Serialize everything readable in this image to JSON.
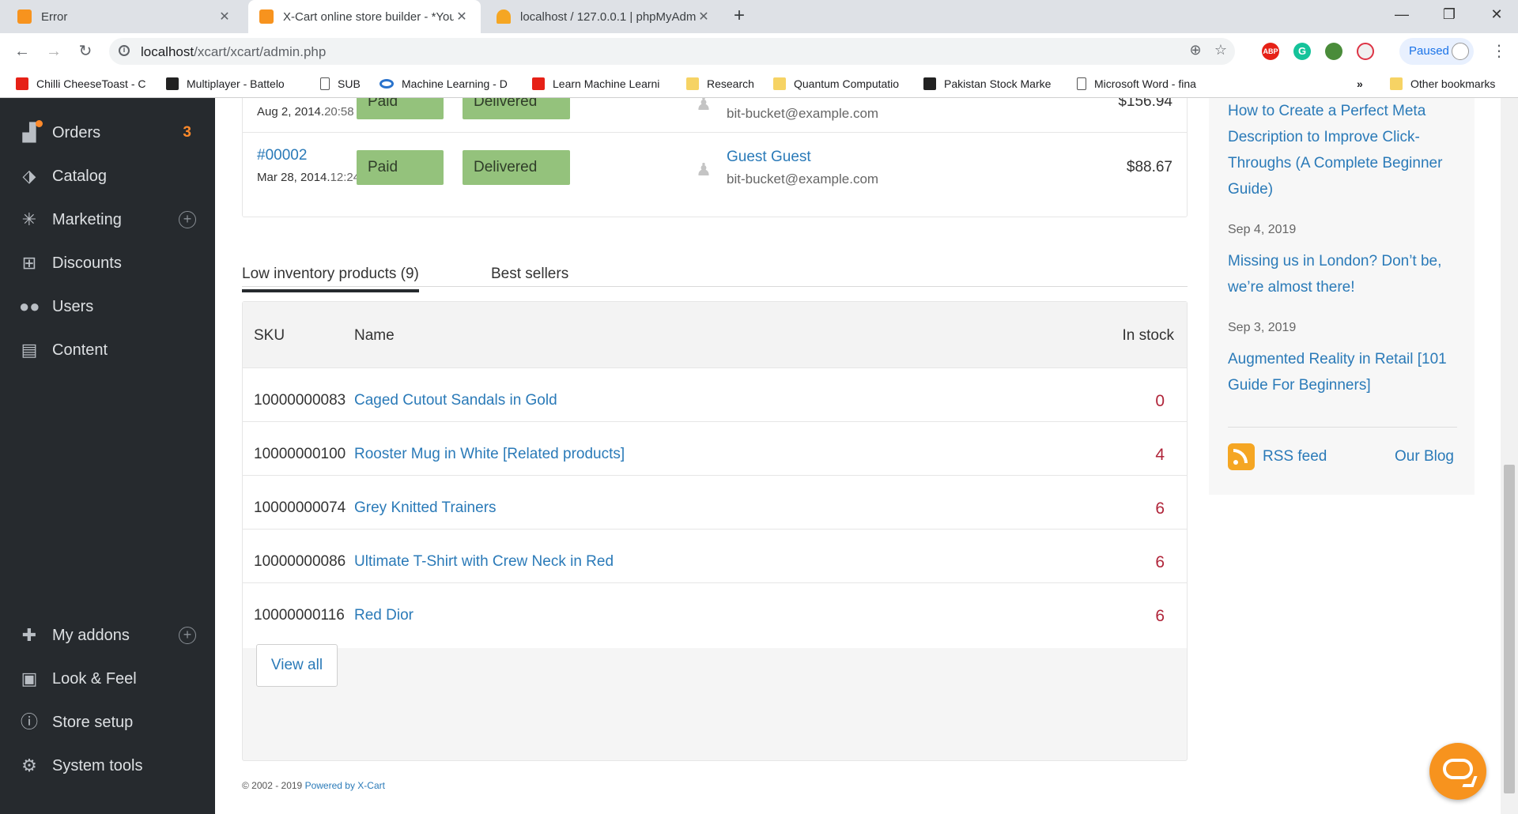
{
  "browser": {
    "tabs": [
      {
        "title": "Error",
        "favicon_color": "#f7931e",
        "active": false
      },
      {
        "title": "X-Cart online store builder - *You",
        "favicon_color": "#f7931e",
        "active": true
      },
      {
        "title": "localhost / 127.0.0.1 | phpMyAdm",
        "favicon_color": "#f5a623",
        "active": false
      }
    ],
    "url_host": "localhost",
    "url_path": "/xcart/xcart/admin.php",
    "profile_label": "Paused",
    "extensions": [
      "ABP",
      "G",
      "",
      ""
    ],
    "bookmarks": [
      {
        "label": "Chilli CheeseToast - C",
        "icon": "youtube-icon"
      },
      {
        "label": "Multiplayer - Battelo",
        "icon": "bl-icon"
      },
      {
        "label": "SUB",
        "icon": "page-icon"
      },
      {
        "label": "Machine Learning - D",
        "icon": "coursera-icon"
      },
      {
        "label": "Learn Machine Learni",
        "icon": "youtube-icon"
      },
      {
        "label": "Research",
        "icon": "folder-icon"
      },
      {
        "label": "Quantum Computatio",
        "icon": "folder-icon"
      },
      {
        "label": "Pakistan Stock Marke",
        "icon": "psx-icon"
      },
      {
        "label": "Microsoft Word - fina",
        "icon": "page-icon"
      }
    ],
    "bookmarks_overflow": "»",
    "other_bookmarks": "Other bookmarks"
  },
  "sidebar": {
    "items": [
      {
        "label": "Orders",
        "icon": "orders-icon",
        "count": "3"
      },
      {
        "label": "Catalog",
        "icon": "tag-icon"
      },
      {
        "label": "Marketing",
        "icon": "network-icon",
        "plus": true
      },
      {
        "label": "Discounts",
        "icon": "gift-icon"
      },
      {
        "label": "Users",
        "icon": "users-icon"
      },
      {
        "label": "Content",
        "icon": "newspaper-icon"
      }
    ],
    "bottom_items": [
      {
        "label": "My addons",
        "icon": "puzzle-icon",
        "plus": true
      },
      {
        "label": "Look & Feel",
        "icon": "image-icon"
      },
      {
        "label": "Store setup",
        "icon": "info-icon"
      },
      {
        "label": "System tools",
        "icon": "gear-icon"
      }
    ]
  },
  "orders": [
    {
      "number": "",
      "date": "Aug 2, 2014.",
      "time": "20:58",
      "payment": "Paid",
      "shipping": "Delivered",
      "customer": "",
      "email": "bit-bucket@example.com",
      "total": "$156.94"
    },
    {
      "number": "#00002",
      "date": "Mar 28, 2014.",
      "time": "12:24",
      "payment": "Paid",
      "shipping": "Delivered",
      "customer": "Guest Guest",
      "email": "bit-bucket@example.com",
      "total": "$88.67"
    }
  ],
  "inventory_tabs": {
    "low_inventory": "Low inventory products (9)",
    "best_sellers": "Best sellers"
  },
  "inventory_table": {
    "headers": {
      "sku": "SKU",
      "name": "Name",
      "stock": "In stock"
    },
    "rows": [
      {
        "sku": "10000000083",
        "name": "Caged Cutout Sandals in Gold",
        "stock": "0"
      },
      {
        "sku": "10000000100",
        "name": "Rooster Mug in White [Related products]",
        "stock": "4"
      },
      {
        "sku": "10000000074",
        "name": "Grey Knitted Trainers",
        "stock": "6"
      },
      {
        "sku": "10000000086",
        "name": "Ultimate T-Shirt with Crew Neck in Red",
        "stock": "6"
      },
      {
        "sku": "10000000116",
        "name": "Red Dior",
        "stock": "6"
      }
    ],
    "view_all": "View all"
  },
  "footer": {
    "copyright": "© 2002 - 2019 ",
    "link": "Powered by X-Cart"
  },
  "news": {
    "items": [
      {
        "date": "",
        "title": "How to Create a Perfect Meta Description to Improve Click-Throughs (A Complete Beginner Guide)"
      },
      {
        "date": "Sep 4, 2019",
        "title": "Missing us in London? Don’t be, we’re almost there!"
      },
      {
        "date": "Sep 3, 2019",
        "title": "Augmented Reality in Retail [101 Guide For Beginners]"
      }
    ],
    "rss_label": "RSS feed",
    "blog_label": "Our Blog"
  },
  "colors": {
    "sidebar_bg": "#262a2e",
    "link": "#2a7ab8",
    "status_green": "#94c27c",
    "stock_red": "#b0253a",
    "accent_orange": "#f7931e"
  }
}
